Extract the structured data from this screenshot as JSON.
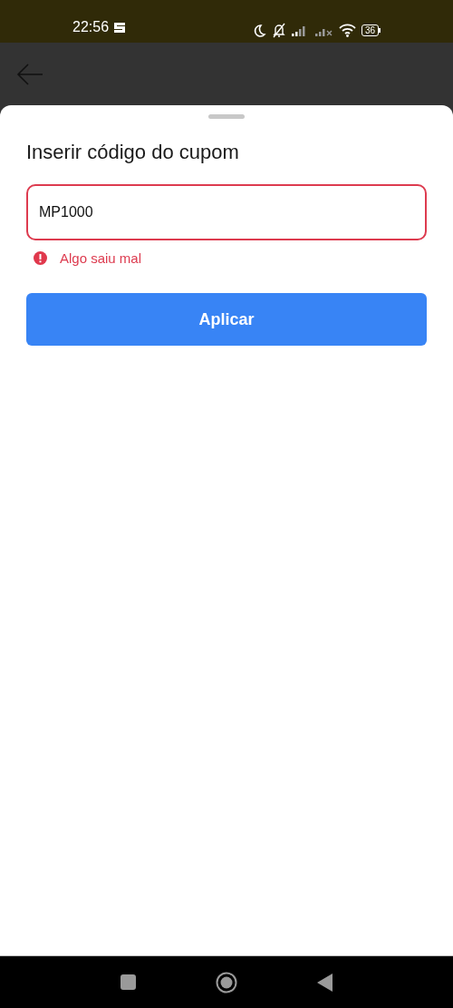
{
  "status_bar": {
    "time": "22:56",
    "battery": "36"
  },
  "sheet": {
    "title": "Inserir código do cupom",
    "coupon_field": {
      "value": "MP1000",
      "error": true
    },
    "error_message": "Algo saiu mal",
    "apply_button": "Aplicar"
  }
}
